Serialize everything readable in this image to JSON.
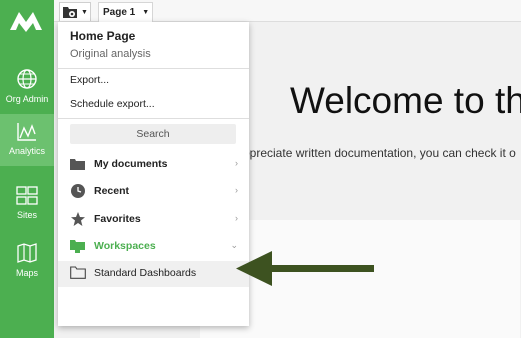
{
  "sidebar": {
    "logo_icon": "brand-mountain-logo",
    "items": [
      {
        "label": "Org Admin",
        "icon": "globe-icon"
      },
      {
        "label": "Analytics",
        "icon": "analytics-chart-icon",
        "active": true
      },
      {
        "label": "Sites",
        "icon": "sites-grid-icon"
      },
      {
        "label": "Maps",
        "icon": "map-icon"
      }
    ]
  },
  "topbar": {
    "doc_menu_icon": "document-gear-icon",
    "page_tab_label": "Page 1"
  },
  "content": {
    "welcome_text": "Welcome to th",
    "subtext": "opreciate written documentation, you can check it o"
  },
  "menu": {
    "title": "Home Page",
    "subtitle": "Original analysis",
    "export_label": "Export...",
    "schedule_label": "Schedule export...",
    "search_placeholder": "Search",
    "nav": [
      {
        "label": "My documents",
        "icon": "folder-icon",
        "chevron": "›"
      },
      {
        "label": "Recent",
        "icon": "clock-icon",
        "chevron": "›"
      },
      {
        "label": "Favorites",
        "icon": "star-icon",
        "chevron": "›"
      },
      {
        "label": "Workspaces",
        "icon": "workspace-folder-icon",
        "chevron": "⌄",
        "expanded": true
      }
    ],
    "workspace_item": "Standard Dashboards"
  },
  "colors": {
    "accent": "#4caf50",
    "arrow": "#3d5220"
  }
}
